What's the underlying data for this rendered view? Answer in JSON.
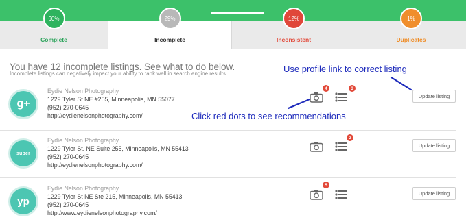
{
  "tabs": [
    {
      "label": "Complete",
      "percent": "60%",
      "color": "#2eb35e"
    },
    {
      "label": "Incomplete",
      "percent": "29%",
      "color": "#b8b8b8"
    },
    {
      "label": "Inconsistent",
      "percent": "12%",
      "color": "#e0473a"
    },
    {
      "label": "Duplicates",
      "percent": "1%",
      "color": "#f08e2c"
    }
  ],
  "header": {
    "headline": "You have 12 incomplete listings. See what to do below.",
    "subline": "Incomplete listings can negatively impact your ability to rank well in search engine results."
  },
  "listings": [
    {
      "icon": "google-plus-icon",
      "avatar_text": "g+",
      "name": "Eydie Nelson Photography",
      "address": "1229 Tyler St NE #255, Minneapolis, MN 55077",
      "phone": "(952) 270-0645",
      "url": "http://eydienelsonphotography.com/",
      "photo_dot": "4",
      "list_dot": "3",
      "button": "Update listing"
    },
    {
      "icon": "superpages-icon",
      "avatar_text": "super",
      "name": "Eydie Nelson Photography",
      "address": "1229 Tyler St. NE Suite 255, Minneapolis, MN 55413",
      "phone": "(952) 270-0645",
      "url": "http://eydienelsonphotography.com/",
      "photo_dot": "",
      "list_dot": "2",
      "button": "Update listing"
    },
    {
      "icon": "yellowpages-icon",
      "avatar_text": "yp",
      "name": "Eydie Nelson Photography",
      "address": "1229 Tyler St NE Ste 215, Minneapolis, MN 55413",
      "phone": "(952) 270-0645",
      "url": "http://www.eydienelsonphotography.com/",
      "photo_dot": "5",
      "list_dot": "",
      "button": "Update listing"
    }
  ],
  "annotations": {
    "profile_link": "Use profile link to correct listing",
    "red_dots": "Click red dots to see recommendations"
  },
  "colors": {
    "green": "#3cc16a",
    "red_dot": "#e24a3a",
    "teal": "#4cc6b2",
    "annotation": "#1f2cbc"
  }
}
